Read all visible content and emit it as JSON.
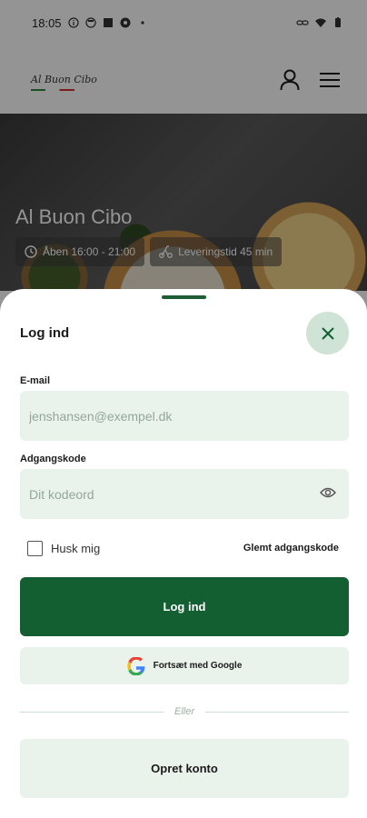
{
  "status_bar": {
    "time": "18:05"
  },
  "header": {
    "logo_text": "Al Buon Cibo"
  },
  "restaurant": {
    "name": "Al Buon Cibo",
    "opening_hours": "Åben 16:00 - 21:00",
    "delivery_time": "Leveringstid 45 min"
  },
  "login": {
    "title": "Log ind",
    "email_label": "E-mail",
    "email_placeholder": "jenshansen@exempel.dk",
    "password_label": "Adgangskode",
    "password_placeholder": "Dit kodeord",
    "remember_label": "Husk mig",
    "forgot_label": "Glemt adgangskode",
    "login_button": "Log ind",
    "google_button": "Fortsæt med Google",
    "divider_text": "Eller",
    "create_account_button": "Opret konto"
  },
  "colors": {
    "primary": "#135f32",
    "field_bg": "#eaf2ec",
    "close_bg": "#cfe4d6"
  }
}
